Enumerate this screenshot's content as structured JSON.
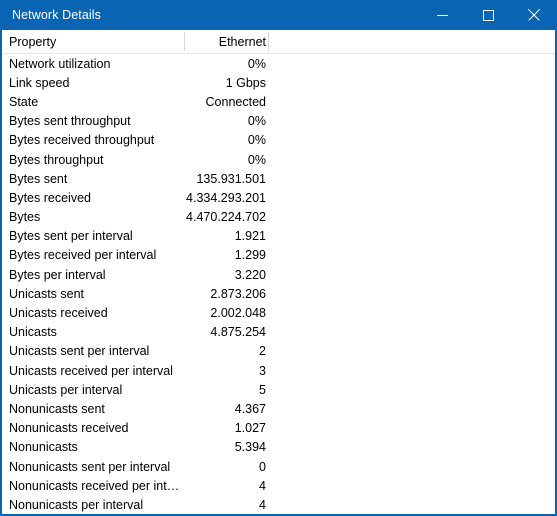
{
  "window": {
    "title": "Network Details",
    "accent_color": "#0a64b4",
    "background_color": "#ffffff",
    "text_color": "#000000"
  },
  "titlebar_buttons": {
    "minimize": {
      "name": "minimize-button",
      "glyph": "minimize-icon"
    },
    "maximize": {
      "name": "maximize-button",
      "glyph": "maximize-icon"
    },
    "close": {
      "name": "close-button",
      "glyph": "close-icon"
    }
  },
  "table": {
    "columns": [
      {
        "key": "property",
        "label": "Property",
        "align": "left"
      },
      {
        "key": "ethernet",
        "label": "Ethernet",
        "align": "right"
      }
    ],
    "rows": [
      {
        "property": "Network utilization",
        "value": "0%"
      },
      {
        "property": "Link speed",
        "value": "1 Gbps"
      },
      {
        "property": "State",
        "value": "Connected"
      },
      {
        "property": "Bytes sent throughput",
        "value": "0%"
      },
      {
        "property": "Bytes received throughput",
        "value": "0%"
      },
      {
        "property": "Bytes throughput",
        "value": "0%"
      },
      {
        "property": "Bytes sent",
        "value": "135.931.501"
      },
      {
        "property": "Bytes received",
        "value": "4.334.293.201"
      },
      {
        "property": "Bytes",
        "value": "4.470.224.702"
      },
      {
        "property": "Bytes sent per interval",
        "value": "1.921"
      },
      {
        "property": "Bytes received per interval",
        "value": "1.299"
      },
      {
        "property": "Bytes per interval",
        "value": "3.220"
      },
      {
        "property": "Unicasts sent",
        "value": "2.873.206"
      },
      {
        "property": "Unicasts received",
        "value": "2.002.048"
      },
      {
        "property": "Unicasts",
        "value": "4.875.254"
      },
      {
        "property": "Unicasts sent per interval",
        "value": "2"
      },
      {
        "property": "Unicasts received per interval",
        "value": "3"
      },
      {
        "property": "Unicasts per interval",
        "value": "5"
      },
      {
        "property": "Nonunicasts sent",
        "value": "4.367"
      },
      {
        "property": "Nonunicasts received",
        "value": "1.027"
      },
      {
        "property": "Nonunicasts",
        "value": "5.394"
      },
      {
        "property": "Nonunicasts sent per interval",
        "value": "0"
      },
      {
        "property": "Nonunicasts received per inter...",
        "value": "4"
      },
      {
        "property": "Nonunicasts per interval",
        "value": "4"
      }
    ]
  }
}
